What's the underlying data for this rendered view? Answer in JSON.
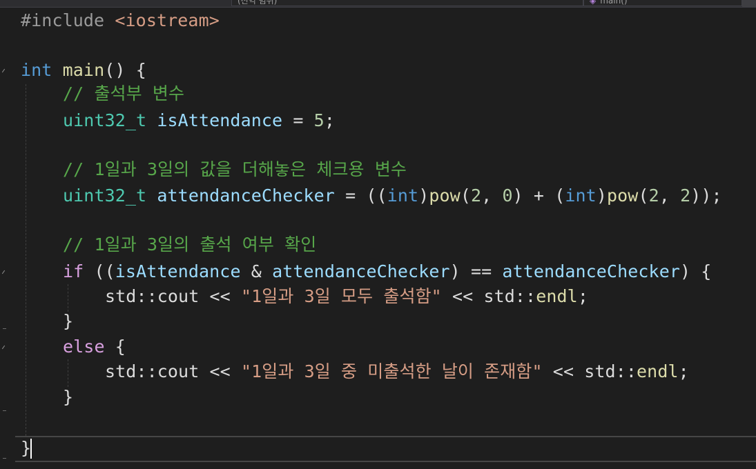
{
  "toolbar": {
    "scope_dropdown": "(전역 범위)",
    "member_dropdown": "main()"
  },
  "code": {
    "l1_pp": "#include",
    "l1_hdr": "<iostream>",
    "l3_kw": "int",
    "l3_fn": "main",
    "l3_rest": "() {",
    "l4_comment": "// 출석부 변수",
    "l5_type": "uint32_t",
    "l5_var": "isAttendance",
    "l5_op": " = ",
    "l5_num": "5",
    "l5_end": ";",
    "l7_comment": "// 1일과 3일의 값을 더해놓은 체크용 변수",
    "l8_type": "uint32_t",
    "l8_var": "attendanceChecker",
    "l8_a": " = ((",
    "l8_int1": "int",
    "l8_b": ")",
    "l8_pow1": "pow",
    "l8_c": "(",
    "l8_n1": "2",
    "l8_d": ", ",
    "l8_n2": "0",
    "l8_e": ") + (",
    "l8_int2": "int",
    "l8_f": ")",
    "l8_pow2": "pow",
    "l8_g": "(",
    "l8_n3": "2",
    "l8_h": ", ",
    "l8_n4": "2",
    "l8_i": "));",
    "l10_comment": "// 1일과 3일의 출석 여부 확인",
    "l11_if": "if",
    "l11_a": " ((",
    "l11_v1": "isAttendance",
    "l11_b": " & ",
    "l11_v2": "attendanceChecker",
    "l11_c": ") == ",
    "l11_v3": "attendanceChecker",
    "l11_d": ") {",
    "l12_a": "std::cout << ",
    "l12_str": "\"1일과 3일 모두 출석함\"",
    "l12_b": " << std::",
    "l12_endl": "endl",
    "l12_c": ";",
    "l13": "}",
    "l14_else": "else",
    "l14_b": " {",
    "l15_a": "std::cout << ",
    "l15_str": "\"1일과 3일 중 미출석한 날이 존재함\"",
    "l15_b": " << std::",
    "l15_endl": "endl",
    "l15_c": ";",
    "l16": "}",
    "l18": "}"
  }
}
